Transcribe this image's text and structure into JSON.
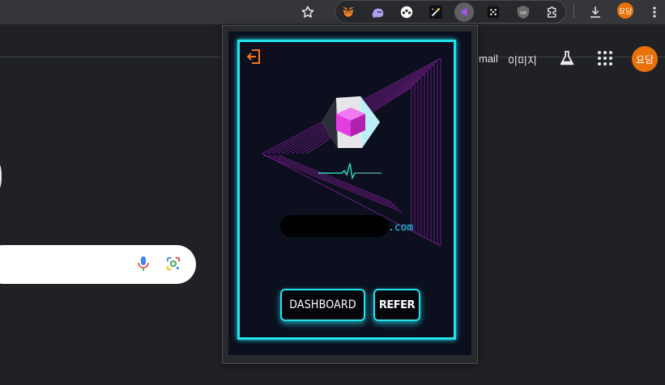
{
  "browser": {
    "extensions": [
      "metamask-icon",
      "ghost-icon",
      "game-icon",
      "dotted-star-icon",
      "active-extension-icon",
      "dots-icon",
      "ublock-icon",
      "puzzle-icon"
    ],
    "profile_label": "요담"
  },
  "google": {
    "gmail_label": "mail",
    "images_label": "이미지",
    "profile_label": "요담"
  },
  "popup": {
    "domain_suffix": ".com",
    "dashboard_label": "DASHBOARD",
    "refer_label": "REFER",
    "accent_color": "#22e3ee",
    "gem_color": "#e43de0"
  }
}
